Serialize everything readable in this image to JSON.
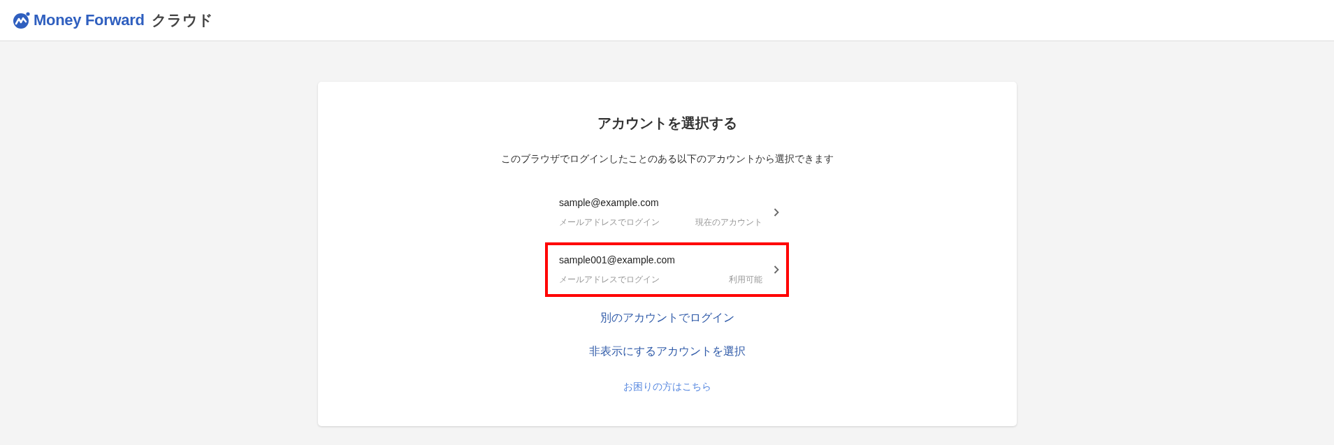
{
  "header": {
    "logo_text": "Money Forward",
    "logo_suffix": "クラウド"
  },
  "card": {
    "title": "アカウントを選択する",
    "description": "このブラウザでログインしたことのある以下のアカウントから選択できます",
    "accounts": [
      {
        "email": "sample@example.com",
        "method": "メールアドレスでログイン",
        "status": "現在のアカウント",
        "highlighted": false
      },
      {
        "email": "sample001@example.com",
        "method": "メールアドレスでログイン",
        "status": "利用可能",
        "highlighted": true
      }
    ],
    "links": [
      {
        "label": "別のアカウントでログイン",
        "kind": "primary"
      },
      {
        "label": "非表示にするアカウントを選択",
        "kind": "primary"
      },
      {
        "label": "お困りの方はこちら",
        "kind": "help"
      }
    ]
  }
}
